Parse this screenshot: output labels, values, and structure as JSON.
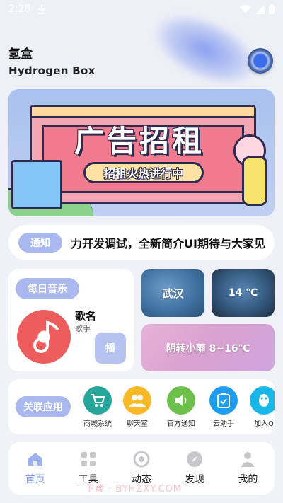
{
  "status_bar": {
    "time": "2:28"
  },
  "header": {
    "title": "氢盒",
    "subtitle": "Hydrogen Box"
  },
  "banner": {
    "title": "广告招租",
    "subtitle": "招租火热进行中"
  },
  "notice": {
    "badge": "通知",
    "text": "力开发调试，全新简介UI期待与大家见"
  },
  "music": {
    "badge": "每日音乐",
    "song": "歌名",
    "artist": "歌手",
    "play_label": "播"
  },
  "weather": {
    "city": "武汉",
    "temp": "14 ℃",
    "condition": "阴转小雨 8~16℃"
  },
  "apps": {
    "badge": "关联应用",
    "items": [
      {
        "label": "商城系统",
        "icon": "cart-icon",
        "color": "#26a69a"
      },
      {
        "label": "聊天室",
        "icon": "people-icon",
        "color": "#f9b826"
      },
      {
        "label": "官方通知",
        "icon": "speaker-icon",
        "color": "#6cc04a"
      },
      {
        "label": "云助手",
        "icon": "clipboard-icon",
        "color": "#1e9df0"
      },
      {
        "label": "加入Q",
        "icon": "penguin-icon",
        "color": "#18b7e8"
      }
    ]
  },
  "nav": {
    "items": [
      {
        "label": "首页",
        "icon": "home-icon"
      },
      {
        "label": "工具",
        "icon": "grid-icon"
      },
      {
        "label": "动态",
        "icon": "aperture-icon"
      },
      {
        "label": "发现",
        "icon": "compass-icon"
      },
      {
        "label": "我的",
        "icon": "user-icon"
      }
    ],
    "active": "首页"
  },
  "watermark": "下载 · BYHZXY.COM",
  "colors": {
    "accent": "#a9b8ef",
    "nav_active": "#7f97ea",
    "music_red": "#ee5d5d"
  }
}
